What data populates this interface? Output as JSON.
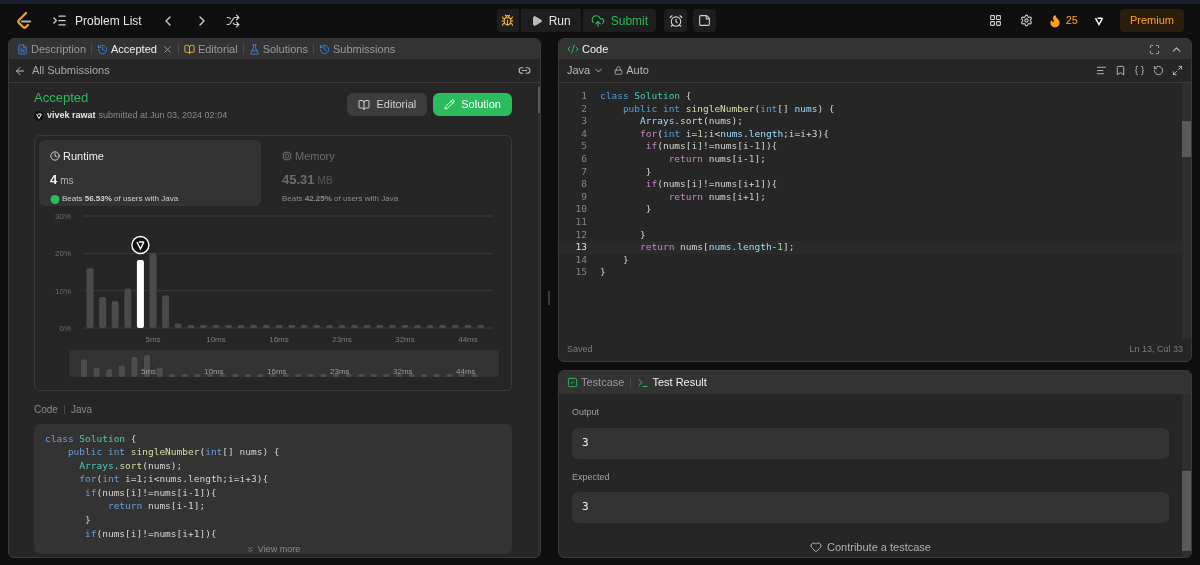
{
  "top_bar": {
    "problem_list": "Problem List",
    "run": "Run",
    "submit": "Submit",
    "streak": "25",
    "premium": "Premium"
  },
  "left_tabs": [
    {
      "label": "Description",
      "selected": false,
      "closable": false
    },
    {
      "label": "Accepted",
      "selected": true,
      "closable": true
    },
    {
      "label": "Editorial",
      "selected": false,
      "closable": false
    },
    {
      "label": "Solutions",
      "selected": false,
      "closable": false
    },
    {
      "label": "Submissions",
      "selected": false,
      "closable": false
    }
  ],
  "back_link": "All Submissions",
  "submission": {
    "status": "Accepted",
    "user": "vivek rawat",
    "submitted": "submitted at Jun 03, 2024 02:04",
    "editorial_button": "Editorial",
    "solution_button": "Solution"
  },
  "stats": [
    {
      "title": "Runtime",
      "value": "4",
      "unit": "ms",
      "beats": "Beats **56.53%** of users with Java",
      "selected": true
    },
    {
      "title": "Memory",
      "value": "45.31",
      "unit": "MB",
      "beats": "Beats **42.25%** of users with Java",
      "selected": false
    }
  ],
  "chart_data": {
    "type": "bar",
    "categories": [
      null,
      null,
      null,
      null,
      null,
      "5ms",
      null,
      null,
      null,
      null,
      "10ms",
      null,
      null,
      null,
      null,
      "16ms",
      null,
      null,
      null,
      null,
      "23ms",
      null,
      null,
      null,
      null,
      "32ms",
      null,
      null,
      null,
      null,
      "44ms",
      null
    ],
    "series": [
      {
        "color": "#4a4a4a",
        "values": [
          16,
          8.3,
          7.2,
          10.5,
          null,
          20,
          8.7,
          1.2,
          0.6,
          0.6,
          0.6,
          0.6,
          0.6,
          0.6,
          0.6,
          0.6,
          0.6,
          0.6,
          0.6,
          0.6,
          0.6,
          0.6,
          0.6,
          0.6,
          0.6,
          0.6,
          0.6,
          0.6,
          0.6,
          0.6,
          0.6,
          0.6
        ]
      },
      {
        "color": "#ffffff",
        "values": [
          null,
          null,
          null,
          null,
          18.2,
          null,
          null,
          null,
          null,
          null,
          null,
          null,
          null,
          null,
          null,
          null,
          null,
          null,
          null,
          null,
          null,
          null,
          null,
          null,
          null,
          null,
          null,
          null,
          null,
          null,
          null,
          null
        ]
      }
    ],
    "ylim": [
      0,
      30
    ],
    "yticks": [
      {
        "value": 0,
        "label": "0%"
      },
      {
        "value": 10,
        "label": "10%"
      },
      {
        "value": 20,
        "label": "20%"
      },
      {
        "value": 30,
        "label": "30%"
      }
    ]
  },
  "brush_labels": [
    "5ms",
    "10ms",
    "16ms",
    "23ms",
    "32ms",
    "44ms"
  ],
  "code_header": {
    "label": "Code",
    "language": "Java"
  },
  "submitted_code": [
    [
      {
        "text": "class ",
        "kind": "kw"
      },
      {
        "text": "Solution",
        "kind": "type"
      },
      {
        "text": " {",
        "kind": "p"
      }
    ],
    [
      {
        "text": "    public int ",
        "kind": "kw"
      },
      {
        "text": "singleNumber",
        "kind": "fn"
      },
      {
        "text": "(",
        "kind": "p"
      },
      {
        "text": "int",
        "kind": "kw"
      },
      {
        "text": "[] nums) {",
        "kind": "p"
      }
    ],
    [
      {
        "text": "      Arrays",
        "kind": "type"
      },
      {
        "text": ".",
        "kind": "p"
      },
      {
        "text": "sort",
        "kind": "fn"
      },
      {
        "text": "(nums);",
        "kind": "p"
      }
    ],
    [
      {
        "text": "      for",
        "kind": "ctl"
      },
      {
        "text": "(",
        "kind": "p"
      },
      {
        "text": "int",
        "kind": "kw"
      },
      {
        "text": " i=1;i<nums.length;i=i+3){",
        "kind": "p"
      }
    ],
    [
      {
        "text": "       if",
        "kind": "ctl"
      },
      {
        "text": "(nums[i]!=nums[i-1]){",
        "kind": "p"
      }
    ],
    [
      {
        "text": "           return",
        "kind": "ctl"
      },
      {
        "text": " nums[i-1];",
        "kind": "p"
      }
    ],
    [
      {
        "text": "       }",
        "kind": "p"
      }
    ],
    [
      {
        "text": "       if",
        "kind": "ctl"
      },
      {
        "text": "(nums[i]!=nums[i+1]){",
        "kind": "p"
      }
    ]
  ],
  "view_more": "View more",
  "editor": {
    "title": "Code",
    "language": "Java",
    "mode": "Auto",
    "status": "Saved",
    "cursor": "Ln 13, Col 33",
    "lines": [
      {
        "n": "1",
        "selected": false,
        "tokens": [
          {
            "text": "class ",
            "kind": "kw"
          },
          {
            "text": "Solution",
            "kind": "type"
          },
          {
            "text": " {",
            "kind": "p"
          }
        ]
      },
      {
        "n": "2",
        "selected": false,
        "tokens": [
          {
            "text": "    public int ",
            "kind": "kw"
          },
          {
            "text": "singleNumber",
            "kind": "fn"
          },
          {
            "text": "(",
            "kind": "p"
          },
          {
            "text": "int",
            "kind": "kw"
          },
          {
            "text": "[] ",
            "kind": "p"
          },
          {
            "text": "nums",
            "kind": "var"
          },
          {
            "text": ") {",
            "kind": "p"
          }
        ]
      },
      {
        "n": "3",
        "selected": false,
        "tokens": [
          {
            "text": "       Arrays",
            "kind": "var"
          },
          {
            "text": ".",
            "kind": "p"
          },
          {
            "text": "sort",
            "kind": "fn"
          },
          {
            "text": "(nums);",
            "kind": "p"
          }
        ]
      },
      {
        "n": "4",
        "selected": false,
        "tokens": [
          {
            "text": "       for",
            "kind": "ctl"
          },
          {
            "text": "(",
            "kind": "p"
          },
          {
            "text": "int",
            "kind": "kw"
          },
          {
            "text": " i=",
            "kind": "p"
          },
          {
            "text": "1",
            "kind": "num"
          },
          {
            "text": ";i<",
            "kind": "p"
          },
          {
            "text": "nums.length",
            "kind": "var"
          },
          {
            "text": ";i=i+3){",
            "kind": "p"
          }
        ]
      },
      {
        "n": "5",
        "selected": false,
        "tokens": [
          {
            "text": "        if",
            "kind": "ctl"
          },
          {
            "text": "(nums[i]!=nums[i-",
            "kind": "p"
          },
          {
            "text": "1",
            "kind": "num"
          },
          {
            "text": "]){",
            "kind": "p"
          }
        ]
      },
      {
        "n": "6",
        "selected": false,
        "tokens": [
          {
            "text": "            return",
            "kind": "ctl"
          },
          {
            "text": " nums[i-",
            "kind": "p"
          },
          {
            "text": "1",
            "kind": "num"
          },
          {
            "text": "];",
            "kind": "p"
          }
        ]
      },
      {
        "n": "7",
        "selected": false,
        "tokens": [
          {
            "text": "        }",
            "kind": "p"
          }
        ]
      },
      {
        "n": "8",
        "selected": false,
        "tokens": [
          {
            "text": "        if",
            "kind": "ctl"
          },
          {
            "text": "(nums[i]!=nums[i+",
            "kind": "p"
          },
          {
            "text": "1",
            "kind": "num"
          },
          {
            "text": "]){",
            "kind": "p"
          }
        ]
      },
      {
        "n": "9",
        "selected": false,
        "tokens": [
          {
            "text": "            return",
            "kind": "ctl"
          },
          {
            "text": " nums[i+",
            "kind": "p"
          },
          {
            "text": "1",
            "kind": "num"
          },
          {
            "text": "];",
            "kind": "p"
          }
        ]
      },
      {
        "n": "10",
        "selected": false,
        "tokens": [
          {
            "text": "        }",
            "kind": "p"
          }
        ]
      },
      {
        "n": "11",
        "selected": false
      },
      {
        "n": "12",
        "selected": false,
        "tokens": [
          {
            "text": "       }",
            "kind": "p"
          }
        ]
      },
      {
        "n": "13",
        "selected": true,
        "tokens": [
          {
            "text": "       return",
            "kind": "ctl"
          },
          {
            "text": " nums[",
            "kind": "p"
          },
          {
            "text": "nums.length",
            "kind": "var"
          },
          {
            "text": "-",
            "kind": "p"
          },
          {
            "text": "1",
            "kind": "num"
          },
          {
            "text": "];",
            "kind": "p"
          }
        ]
      },
      {
        "n": "14",
        "selected": false,
        "tokens": [
          {
            "text": "    }",
            "kind": "p"
          }
        ]
      },
      {
        "n": "15",
        "selected": false,
        "tokens": [
          {
            "text": "}",
            "kind": "p"
          }
        ]
      }
    ]
  },
  "test_panel": {
    "tabs": [
      {
        "label": "Testcase",
        "selected": false
      },
      {
        "label": "Test Result",
        "selected": true
      }
    ],
    "fields": [
      {
        "label": "Output",
        "value": "3"
      },
      {
        "label": "Expected",
        "value": "3"
      }
    ],
    "contribute": "Contribute a testcase"
  }
}
